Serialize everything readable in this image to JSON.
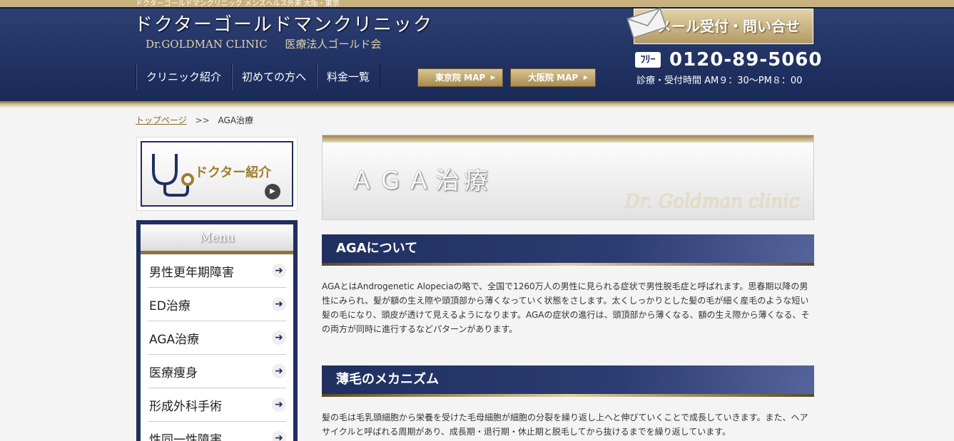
{
  "tagline": "ドクターゴールドマンクリニック メンズヘルス外来 大阪・東京",
  "header": {
    "title": "ドクターゴールドマンクリニック",
    "subtitle_en": "Dr.GOLDMAN CLINIC",
    "subtitle_jp": "医療法人ゴールド会",
    "mail_button": "メール受付・問い合せ",
    "phone_icon": "ﾌﾘｰ",
    "phone": "0120-89-5060",
    "hours": "診療・受付時間 AM９：30〜PM８：00"
  },
  "nav": [
    {
      "label": "クリニック紹介"
    },
    {
      "label": "初めての方へ"
    },
    {
      "label": "料金一覧"
    }
  ],
  "map_buttons": [
    {
      "label": "東京院 MAP"
    },
    {
      "label": "大阪院 MAP"
    }
  ],
  "breadcrumb": {
    "home": "トップページ",
    "separator": ">>",
    "current": "AGA治療"
  },
  "sidebar": {
    "doctor_label": "ドクター紹介",
    "menu_title": "Menu",
    "menu_items": [
      {
        "label": "男性更年期障害"
      },
      {
        "label": "ED治療"
      },
      {
        "label": "AGA治療"
      },
      {
        "label": "医療痩身"
      },
      {
        "label": "形成外科手術"
      },
      {
        "label": "性同一性障害"
      }
    ]
  },
  "main": {
    "page_title": "ＡＧＡ治療",
    "brand_script": "Dr. Goldman clinic",
    "sections": [
      {
        "heading": "AGAについて",
        "text": "AGAとはAndrogenetic Alopeciaの略で、全国で1260万人の男性に見られる症状で男性脱毛症と呼ばれます。思春期以降の男性にみられ、髪が額の生え際や頭頂部から薄くなっていく状態をさします。太くしっかりとした髪の毛が細く産毛のような短い髪の毛になり、頭皮が透けて見えるようになります。AGAの症状の進行は、頭頂部から薄くなる、額の生え際から薄くなる、その両方が同時に進行するなどパターンがあります。"
      },
      {
        "heading": "薄毛のメカニズム",
        "text": "髪の毛は毛乳頭細胞から栄養を受けた毛母細胞が細胞の分裂を繰り返し上へと伸びていくことで成長していきます。また、ヘアサイクルと呼ばれる周期があり、成長期・退行期・休止期と脱毛してから抜けるまでを繰り返しています。"
      }
    ]
  },
  "colors": {
    "navy": "#1f2f60",
    "gold": "#b39a66",
    "background": "#f4f4f4"
  }
}
